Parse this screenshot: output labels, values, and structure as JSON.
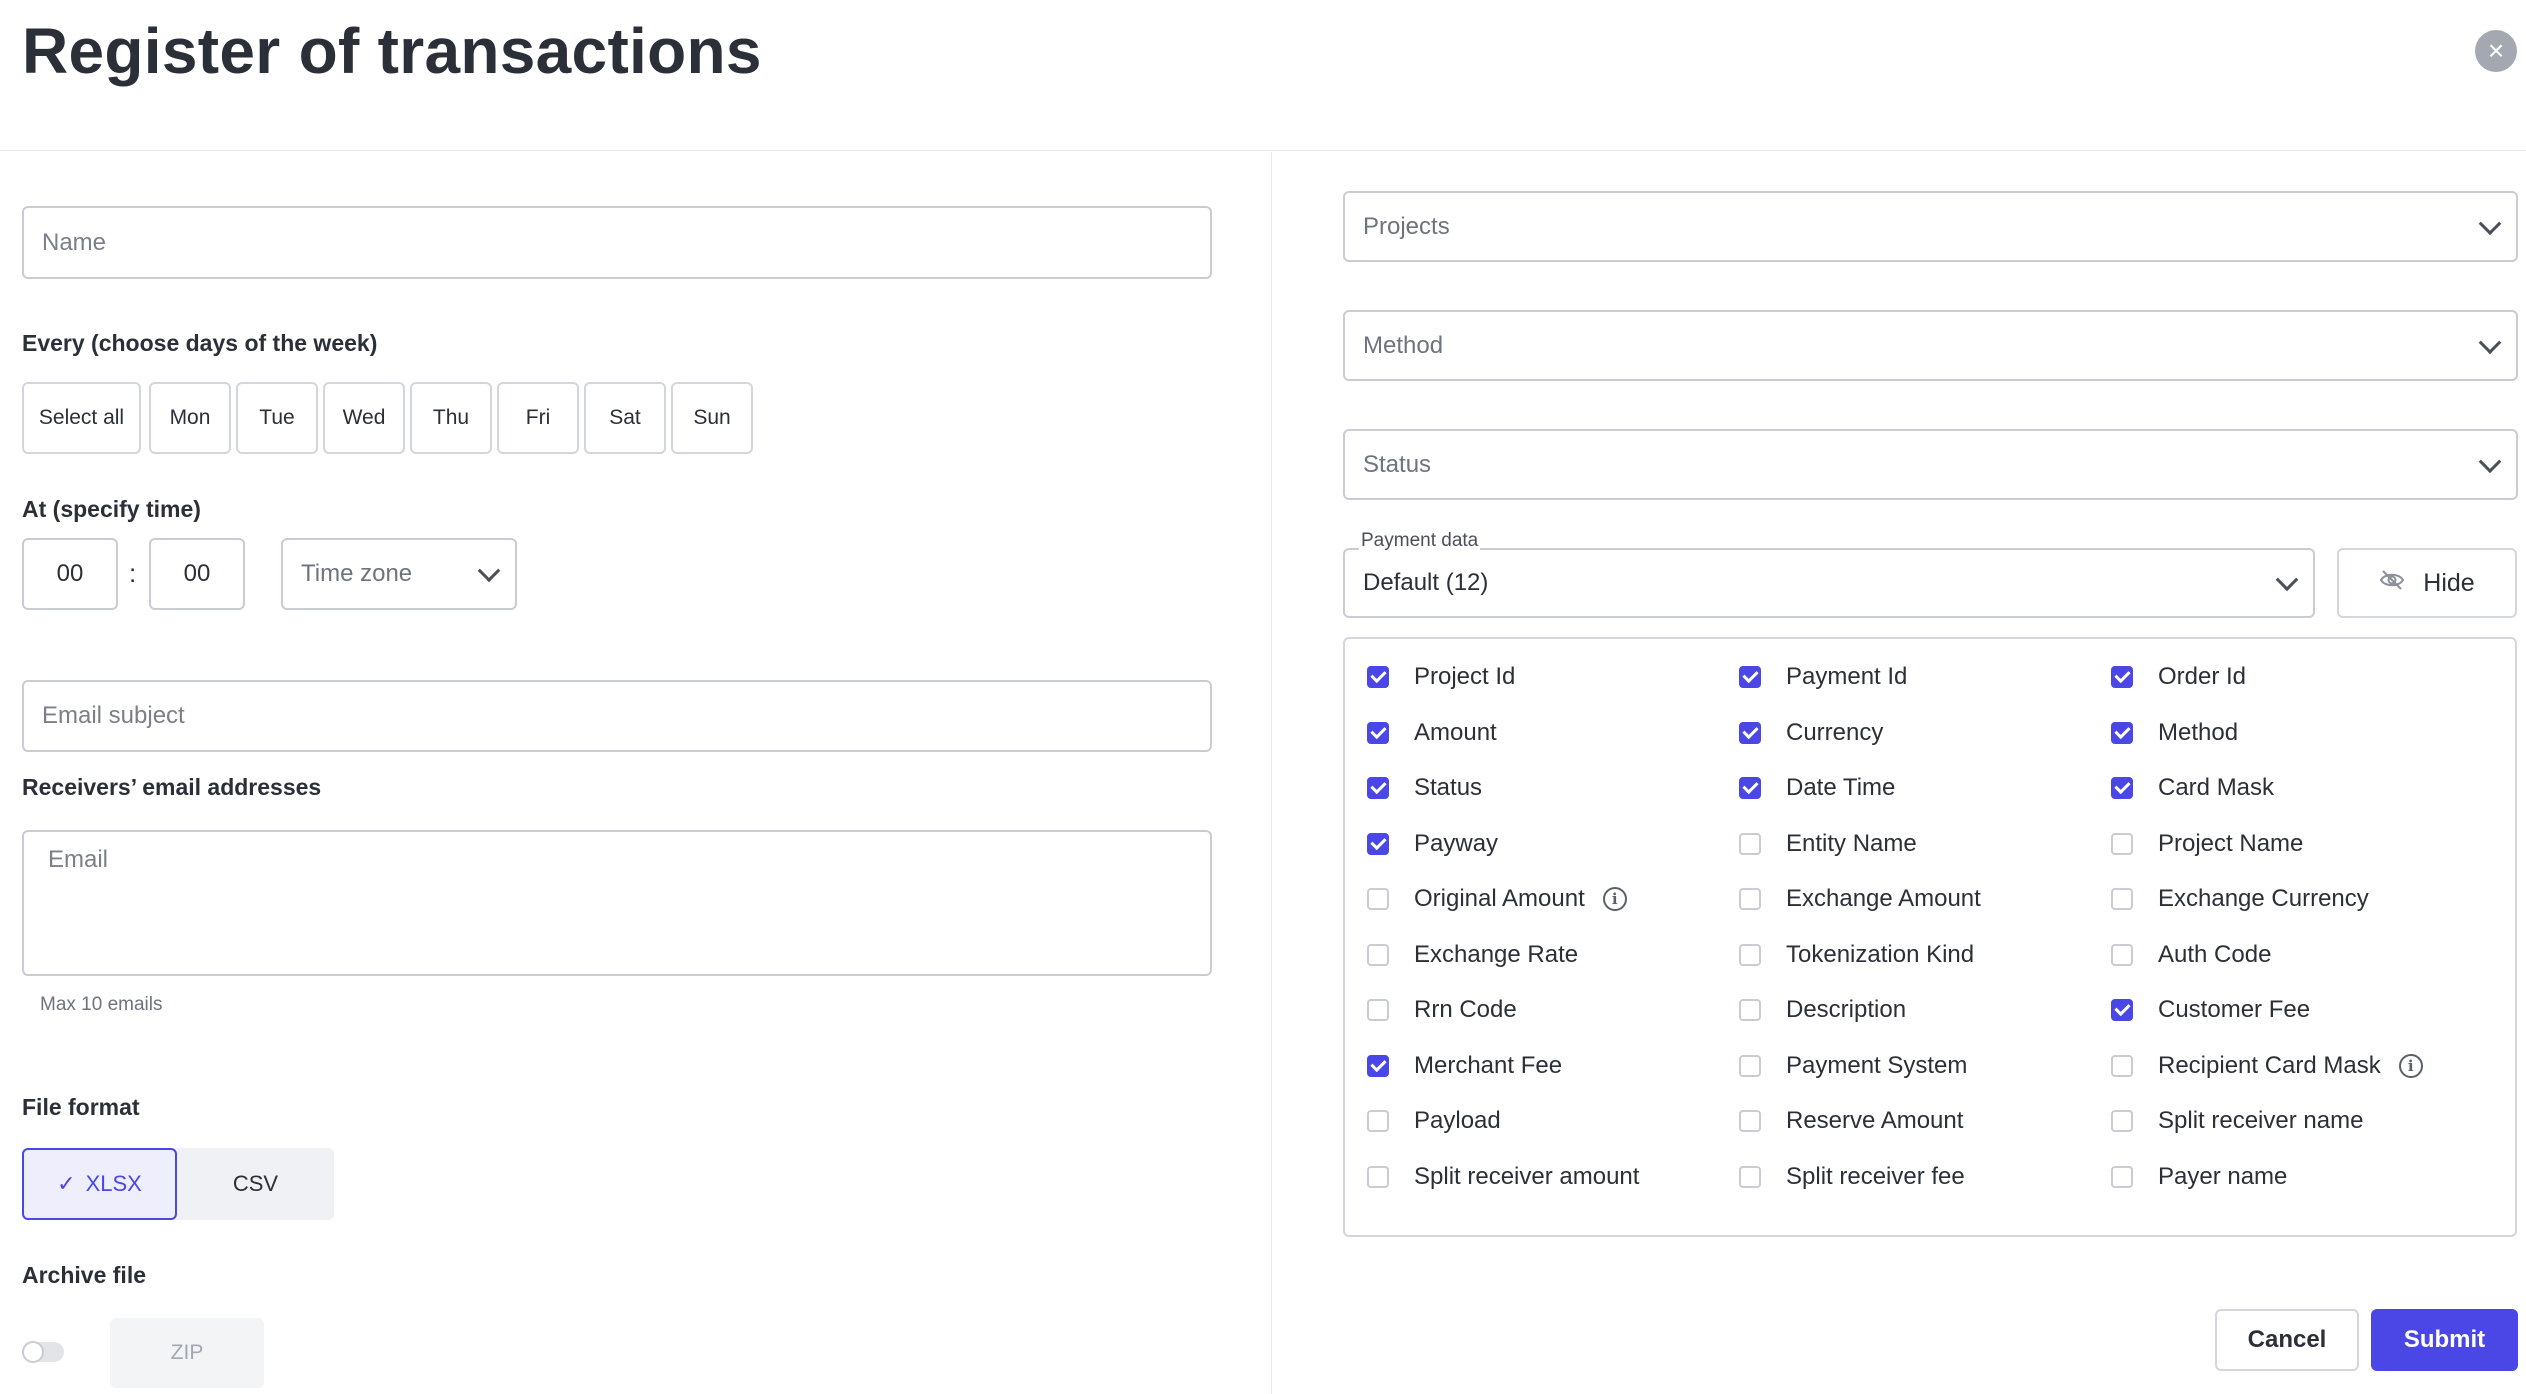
{
  "header": {
    "title": "Register of transactions",
    "close_icon": "close-icon"
  },
  "left": {
    "name_placeholder": "Name",
    "days_label": "Every (choose days of the week)",
    "days": [
      "Select all",
      "Mon",
      "Tue",
      "Wed",
      "Thu",
      "Fri",
      "Sat",
      "Sun"
    ],
    "time_label": "At (specify time)",
    "hours": "00",
    "colon": ":",
    "minutes": "00",
    "timezone_placeholder": "Time zone",
    "email_subject_placeholder": "Email subject",
    "receivers_label": "Receivers’ email addresses",
    "email_placeholder": "Email",
    "max_emails_hint": "Max 10 emails",
    "file_format_label": "File format",
    "formats": {
      "xlsx": "XLSX",
      "csv": "CSV",
      "selected": "XLSX",
      "check_glyph": "✓"
    },
    "archive_label": "Archive file",
    "archive_enabled": false,
    "zip_label": "ZIP"
  },
  "right": {
    "projects_placeholder": "Projects",
    "method_placeholder": "Method",
    "status_placeholder": "Status",
    "payment_data_label": "Payment data",
    "payment_data_value": "Default (12)",
    "hide_label": "Hide",
    "hide_icon": "eye-off-icon",
    "columns": [
      [
        {
          "label": "Project Id",
          "checked": true
        },
        {
          "label": "Amount",
          "checked": true
        },
        {
          "label": "Status",
          "checked": true
        },
        {
          "label": "Payway",
          "checked": true
        },
        {
          "label": "Original Amount",
          "checked": false,
          "info": true
        },
        {
          "label": "Exchange Rate",
          "checked": false
        },
        {
          "label": "Rrn Code",
          "checked": false
        },
        {
          "label": "Merchant Fee",
          "checked": true
        },
        {
          "label": "Payload",
          "checked": false
        },
        {
          "label": "Split receiver amount",
          "checked": false
        }
      ],
      [
        {
          "label": "Payment Id",
          "checked": true
        },
        {
          "label": "Currency",
          "checked": true
        },
        {
          "label": "Date Time",
          "checked": true
        },
        {
          "label": "Entity Name",
          "checked": false
        },
        {
          "label": "Exchange Amount",
          "checked": false
        },
        {
          "label": "Tokenization Kind",
          "checked": false
        },
        {
          "label": "Description",
          "checked": false
        },
        {
          "label": "Payment System",
          "checked": false
        },
        {
          "label": "Reserve Amount",
          "checked": false
        },
        {
          "label": "Split receiver fee",
          "checked": false
        }
      ],
      [
        {
          "label": "Order Id",
          "checked": true
        },
        {
          "label": "Method",
          "checked": true
        },
        {
          "label": "Card Mask",
          "checked": true
        },
        {
          "label": "Project Name",
          "checked": false
        },
        {
          "label": "Exchange Currency",
          "checked": false
        },
        {
          "label": "Auth Code",
          "checked": false
        },
        {
          "label": "Customer Fee",
          "checked": true
        },
        {
          "label": "Recipient Card Mask",
          "checked": false,
          "info": true
        },
        {
          "label": "Split receiver name",
          "checked": false
        },
        {
          "label": "Payer name",
          "checked": false
        }
      ]
    ],
    "info_glyph": "i",
    "cancel_label": "Cancel",
    "submit_label": "Submit"
  },
  "colors": {
    "accent": "#4b47e6",
    "text": "#2b2f38",
    "border": "#c9ccd3"
  }
}
